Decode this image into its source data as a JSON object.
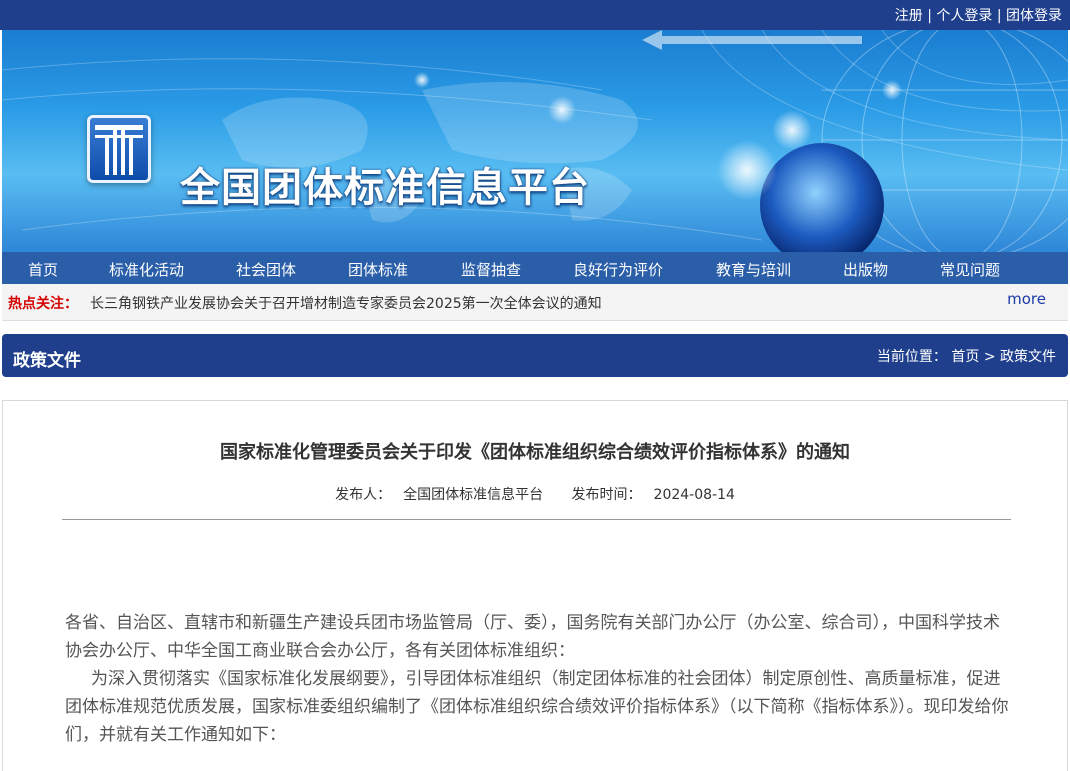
{
  "header": {
    "links": [
      "注册",
      "个人登录",
      "团体登录"
    ],
    "separator": "|"
  },
  "banner": {
    "site_title": "全国团体标准信息平台",
    "logo": "tt-logo-icon"
  },
  "nav": {
    "items": [
      "首页",
      "标准化活动",
      "社会团体",
      "团体标准",
      "监督抽查",
      "良好行为评价",
      "教育与培训",
      "出版物",
      "常见问题"
    ]
  },
  "hot": {
    "label": "热点关注：",
    "text": "长三角钢铁产业发展协会关于召开增材制造专家委员会2025第一次全体会议的通知",
    "more": "more"
  },
  "section": {
    "title": "政策文件",
    "crumb_prefix": "当前位置：",
    "crumb_home": "首页",
    "crumb_sep": ">",
    "crumb_current": "政策文件"
  },
  "article": {
    "title": "国家标准化管理委员会关于印发《团体标准组织综合绩效评价指标体系》的通知",
    "publisher_label": "发布人：",
    "publisher": "全国团体标准信息平台",
    "date_label": "发布时间：",
    "date": "2024-08-14",
    "paragraphs": [
      "各省、自治区、直辖市和新疆生产建设兵团市场监管局（厅、委），国务院有关部门办公厅（办公室、综合司），中国科学技术协会办公厅、中华全国工商业联合会办公厅，各有关团体标准组织：",
      "为深入贯彻落实《国家标准化发展纲要》，引导团体标准组织（制定团体标准的社会团体）制定原创性、高质量标准，促进团体标准规范优质发展，国家标准委组织编制了《团体标准组织综合绩效评价指标体系》（以下简称《指标体系》）。现印发给你们，并就有关工作通知如下："
    ]
  },
  "colors": {
    "top_bar": "#1f3f8c",
    "nav_bar": "#2a5ea9",
    "hot_label": "#d40000",
    "more_link": "#1a3aa8"
  }
}
